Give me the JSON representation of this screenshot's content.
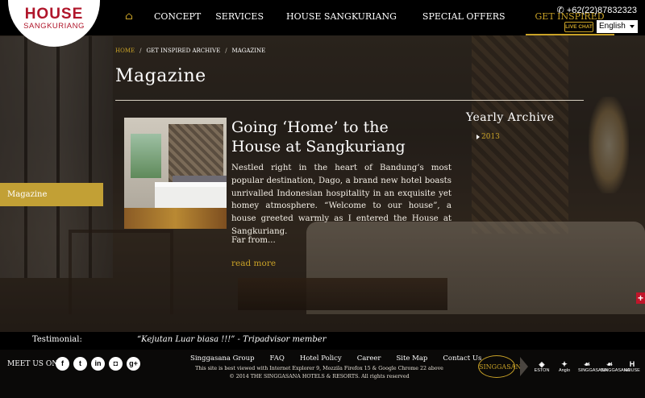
{
  "header": {
    "logo_line1": "HOUSE",
    "logo_line2": "SANGKURIANG",
    "home_icon": "home-icon",
    "nav": [
      {
        "label": "CONCEPT"
      },
      {
        "label": "SERVICES"
      },
      {
        "label": "HOUSE SANGKURIANG"
      },
      {
        "label": "SPECIAL OFFERS"
      },
      {
        "label": "GET INSPIRED"
      }
    ],
    "active_nav": "GET INSPIRED",
    "phone_icon": "phone-icon",
    "phone": "+62(22)87832323",
    "live_chat": "LIVE CHAT",
    "language": "English"
  },
  "breadcrumb": [
    "HOME",
    "GET INSPIRED ARCHIVE",
    "MAGAZINE"
  ],
  "breadcrumb_separator": "/",
  "page_title": "Magazine",
  "sidebar_tab": "Magazine",
  "article": {
    "title": "Going ‘Home’ to the House at Sangkuriang",
    "body": "Nestled right in the heart of Bandung’s most popular destination, Dago, a brand new hotel boasts unrivalled Indonesian hospitality in an exquisite yet homey atmosphere. “Welcome to our house”, a house greeted warmly as I entered the House at Sangkuriang.",
    "more": "Far from...",
    "read_more": "read more"
  },
  "archive": {
    "title": "Yearly Archive",
    "years": [
      "2013"
    ]
  },
  "plus_button": "+",
  "testimonial": {
    "label": "Testimonial:",
    "quote": "“Kejutan Luar biasa !!!” - Tripadvisor member"
  },
  "footer": {
    "meet_us": "MEET US ON",
    "socials": [
      {
        "icon": "facebook-icon",
        "glyph": "f"
      },
      {
        "icon": "twitter-icon",
        "glyph": "t"
      },
      {
        "icon": "linkedin-icon",
        "glyph": "in"
      },
      {
        "icon": "flickr-icon",
        "glyph": "◘"
      },
      {
        "icon": "googleplus-icon",
        "glyph": "g+"
      }
    ],
    "links": [
      "Singgasana Group",
      "FAQ",
      "Hotel Policy",
      "Career",
      "Site Map",
      "Contact Us"
    ],
    "note_line1": "This site is best viewed with Internet Explorer 9, Mozzila Firefox 15 & Google Chrome 22 above",
    "note_line2": "© 2014 THE SINGGASANA HOTELS & RESORTS. All rights reserved",
    "brand_main": "SINGGASANA",
    "brands": [
      "ESTON",
      "Anglo",
      "SINGGASANA",
      "SINGGASANA",
      "HOUSE"
    ]
  },
  "colors": {
    "accent": "#c9a227",
    "brand_red": "#b0152a",
    "header_bg": "#000000"
  }
}
